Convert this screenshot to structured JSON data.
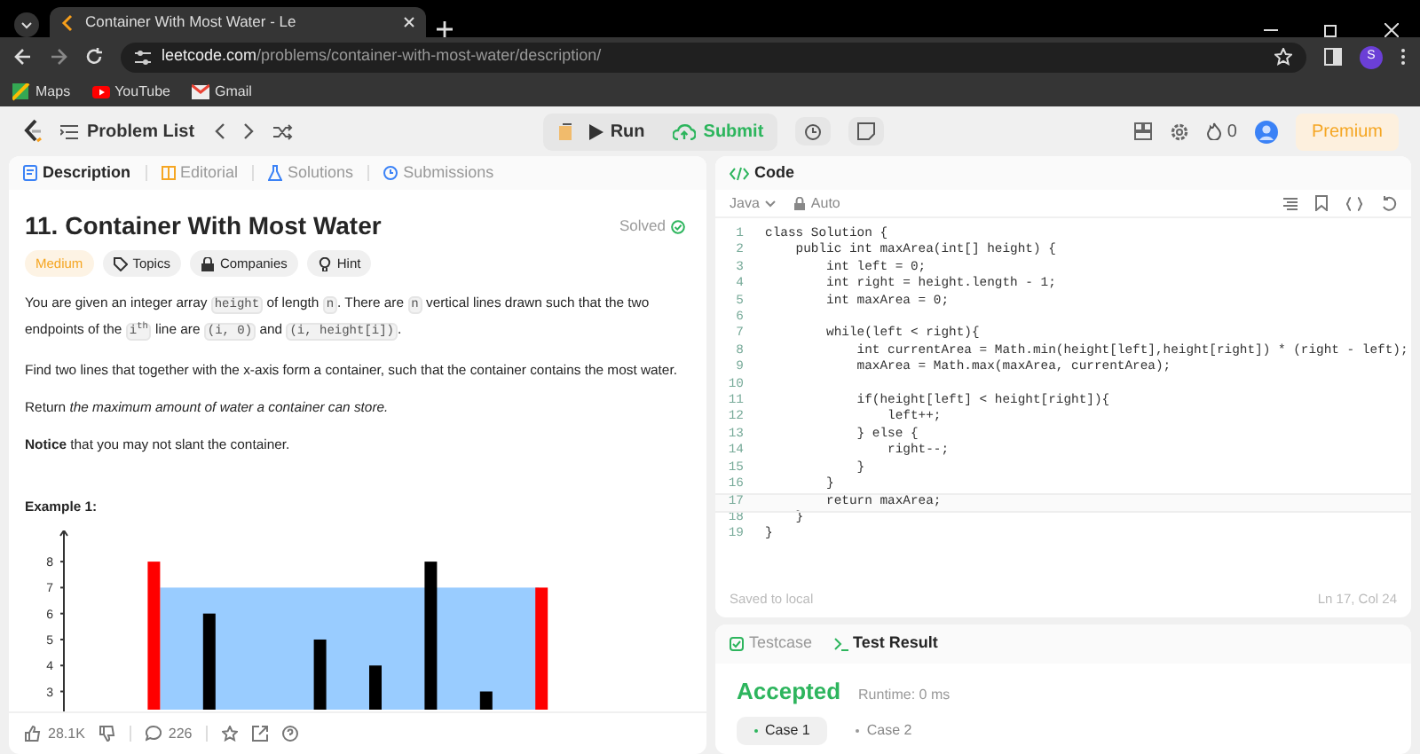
{
  "browser": {
    "tab_title": "Container With Most Water - Le",
    "url_host": "leetcode.com",
    "url_path": "/problems/container-with-most-water/description/",
    "profile": "S",
    "bookmarks": [
      "Maps",
      "YouTube",
      "Gmail"
    ]
  },
  "topbar": {
    "problem_list": "Problem List",
    "run": "Run",
    "submit": "Submit",
    "streak": "0",
    "premium": "Premium"
  },
  "left_tabs": [
    {
      "label": "Description",
      "selected": true
    },
    {
      "label": "Editorial",
      "selected": false
    },
    {
      "label": "Solutions",
      "selected": false
    },
    {
      "label": "Submissions",
      "selected": false
    }
  ],
  "problem": {
    "title": "11. Container With Most Water",
    "status": "Solved",
    "difficulty": "Medium",
    "tags": [
      "Topics",
      "Companies",
      "Hint"
    ],
    "paragraphs": [
      [
        {
          "text": "You are given an integer array ",
          "kind": "text"
        },
        {
          "text": "height",
          "kind": "code"
        },
        {
          "text": " of length ",
          "kind": "text"
        },
        {
          "text": "n",
          "kind": "code"
        },
        {
          "text": ". There are ",
          "kind": "text"
        },
        {
          "text": "n",
          "kind": "code"
        },
        {
          "text": " vertical lines drawn such that the two endpoints of the ",
          "kind": "text"
        },
        {
          "text": "i$^{th}$",
          "kind": "code"
        },
        {
          "text": " line are ",
          "kind": "text"
        },
        {
          "text": "(i, 0)",
          "kind": "code"
        },
        {
          "text": " and ",
          "kind": "text"
        },
        {
          "text": "(i, height[i])",
          "kind": "code"
        },
        {
          "text": ".",
          "kind": "text"
        }
      ],
      [
        {
          "text": "Find two lines that together with the x-axis form a container, such that the container contains the most water.",
          "kind": "text"
        }
      ],
      [
        {
          "text": "Return *the maximum amount of water a container can store.*",
          "kind": "text"
        }
      ],
      [
        {
          "text": "**Notice** that you may not slant the container.",
          "kind": "text"
        }
      ]
    ],
    "example_title": "Example 1:",
    "example_figure": {
      "axis_labels": [
        "8",
        "7",
        "6",
        "5",
        "4",
        "3"
      ]
    }
  },
  "left_footer": {
    "likes": "28.1K",
    "comments": "226"
  },
  "code_panel": {
    "title": "Code",
    "language": "Java",
    "mode": "Auto",
    "status": "Saved to local",
    "cursor": "Ln 17, Col 24",
    "lines": [
      {
        "number": "1",
        "text": "class Solution {",
        "current": false
      },
      {
        "number": "2",
        "text": "    public int maxArea(int[] height) {",
        "current": false
      },
      {
        "number": "3",
        "text": "        int left = 0;",
        "current": false
      },
      {
        "number": "4",
        "text": "        int right = height.length - 1;",
        "current": false
      },
      {
        "number": "5",
        "text": "        int maxArea = 0;",
        "current": false
      },
      {
        "number": "6",
        "current": false
      },
      {
        "number": "7",
        "text": "        while(left < right){",
        "current": false
      },
      {
        "number": "8",
        "text": "            int currentArea = Math.min(height[left],height[right]) * (right - left);",
        "current": false
      },
      {
        "number": "9",
        "text": "            maxArea = Math.max(maxArea, currentArea);",
        "current": false
      },
      {
        "number": "10",
        "current": false
      },
      {
        "number": "11",
        "text": "            if(height[left] < height[right]){",
        "current": false
      },
      {
        "number": "12",
        "text": "                left++;",
        "current": false
      },
      {
        "number": "13",
        "text": "            } else {",
        "current": false
      },
      {
        "number": "14",
        "text": "                right--;",
        "current": false
      },
      {
        "number": "15",
        "text": "            }",
        "current": false
      },
      {
        "number": "16",
        "text": "        }",
        "current": false
      },
      {
        "number": "17",
        "text": "        return maxArea;",
        "current": true
      },
      {
        "number": "18",
        "text": "    }",
        "current": false
      },
      {
        "number": "19",
        "text": "}",
        "current": false
      }
    ]
  },
  "result_panel": {
    "tabs": [
      {
        "label": "Testcase",
        "selected": false
      },
      {
        "label": "Test Result",
        "selected": true
      }
    ],
    "verdict": "Accepted",
    "runtime": "Runtime: 0 ms",
    "cases": [
      {
        "label": "Case 1",
        "selected": true
      },
      {
        "label": "Case 2",
        "selected": false
      }
    ]
  }
}
